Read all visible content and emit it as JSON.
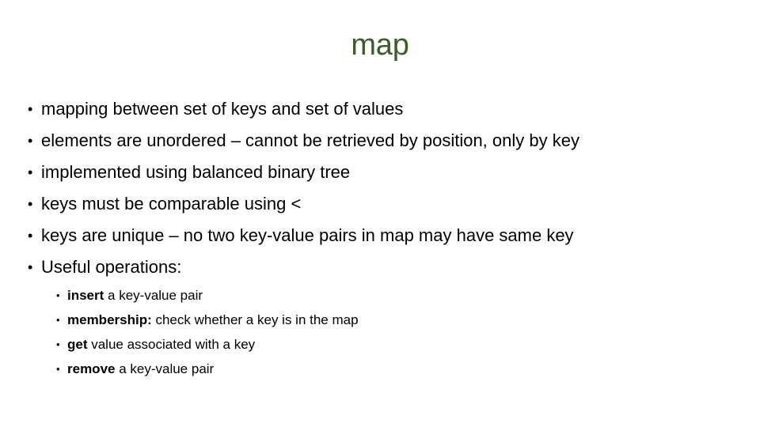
{
  "slide": {
    "title": "map",
    "title_color": "#3c5c28",
    "text_color": "#000000",
    "background_color": "#ffffff",
    "bullet_marker": "•"
  },
  "bullets": [
    {
      "text": "mapping between set of keys and set of values"
    },
    {
      "text": "elements are unordered – cannot be retrieved by position, only by key"
    },
    {
      "text": "implemented using balanced binary tree"
    },
    {
      "text": "keys must be comparable using <"
    },
    {
      "text": "keys are unique – no two key-value pairs in map may have same key"
    },
    {
      "text": "Useful operations:"
    }
  ],
  "sub_bullets": [
    {
      "lead": "insert",
      "rest": " a key-value pair"
    },
    {
      "lead": "membership:",
      "rest": " check whether a key is in the map"
    },
    {
      "lead": "get",
      "rest": " value associated with a key"
    },
    {
      "lead": "remove",
      "rest": " a key-value pair"
    }
  ]
}
